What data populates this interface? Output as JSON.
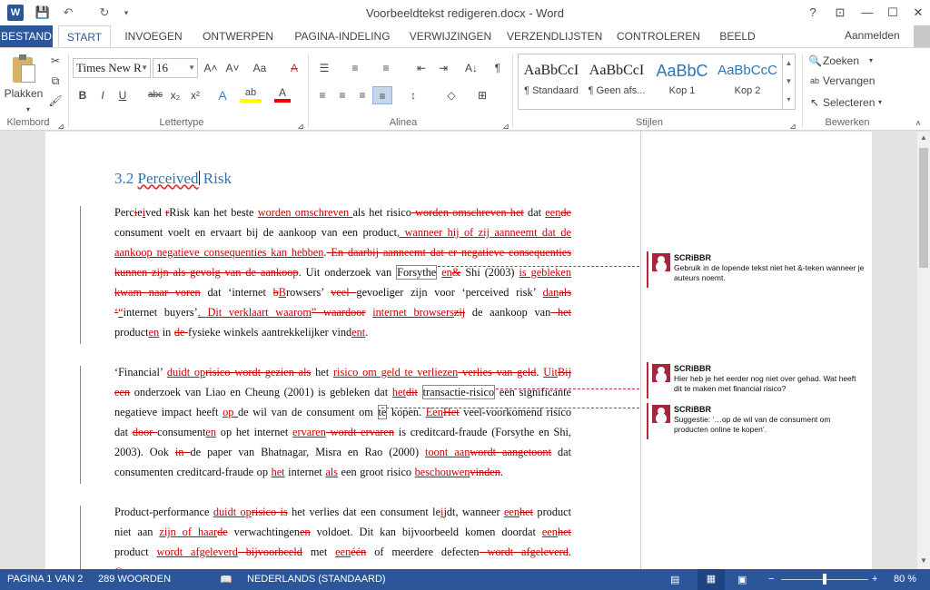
{
  "titlebar": {
    "app_icon": "W",
    "save": "💾",
    "undo": "↶",
    "redo": "↻",
    "customize": "▾",
    "title": "Voorbeeldtekst redigeren.docx - Word",
    "help": "?",
    "ribbon_opts": "⊡",
    "minimize": "—",
    "maximize": "☐",
    "close": "✕"
  },
  "tabs": {
    "file": "BESTAND",
    "items": [
      "START",
      "INVOEGEN",
      "ONTWERPEN",
      "PAGINA-INDELING",
      "VERWIJZINGEN",
      "VERZENDLIJSTEN",
      "CONTROLEREN",
      "BEELD"
    ],
    "signin": "Aanmelden"
  },
  "ribbon": {
    "clipboard": {
      "paste": "Plakken",
      "label": "Klembord"
    },
    "font": {
      "name": "Times New R",
      "size": "16",
      "grow": "A˄",
      "shrink": "A˅",
      "case": "Aa",
      "clear": "A",
      "bold": "B",
      "italic": "I",
      "underline": "U",
      "strike": "abc",
      "sub": "x₂",
      "sup": "x²",
      "effects": "A",
      "highlight": "ab",
      "color": "A",
      "label": "Lettertype"
    },
    "paragraph": {
      "bullets": "☰",
      "numbering": "≡",
      "multilevel": "≡",
      "decrease": "⇤",
      "increase": "⇥",
      "sort": "A↓",
      "pilcrow": "¶",
      "left": "≡",
      "center": "≡",
      "right": "≡",
      "justify": "≡",
      "spacing": "↕",
      "shading": "◇",
      "borders": "⊞",
      "label": "Alinea"
    },
    "styles": {
      "items": [
        {
          "preview": "AaBbCcI",
          "name": "¶ Standaard"
        },
        {
          "preview": "AaBbCcI",
          "name": "¶ Geen afs..."
        },
        {
          "preview": "AaBbC",
          "name": "Kop 1"
        },
        {
          "preview": "AaBbCcC",
          "name": "Kop 2"
        }
      ],
      "label": "Stijlen"
    },
    "editing": {
      "find": "Zoeken",
      "replace": "Vervangen",
      "select": "Selecteren",
      "label": "Bewerken"
    }
  },
  "document": {
    "heading": {
      "num": "3.2 ",
      "word1": "Perceived",
      "word2": " Risk"
    },
    "p1": [
      [
        "n",
        "Perc"
      ],
      [
        "d",
        "i"
      ],
      [
        "n",
        "e"
      ],
      [
        "i",
        "i"
      ],
      [
        "n",
        "ved "
      ],
      [
        "d",
        "r"
      ],
      [
        "n",
        "Risk kan het beste "
      ],
      [
        "i",
        "worden omschreven "
      ],
      [
        "n",
        "als het risico"
      ],
      [
        "d",
        " worden omschreven het"
      ],
      [
        "n",
        " dat "
      ],
      [
        "i",
        "een"
      ],
      [
        "d",
        "de"
      ],
      [
        "n",
        " consument voelt en ervaart bij de aankoop van een product"
      ],
      [
        "i",
        ", wanneer hij of zij aanneemt dat de aankoop negatieve consequenties kan hebben"
      ],
      [
        "n",
        "."
      ],
      [
        "d",
        " En daarbij aanneemt dat er negatieve consequenties kunnen zijn als gevolg van de aankoop"
      ],
      [
        "n",
        ". Uit onderzoek van "
      ],
      [
        "b",
        "Forsythe"
      ],
      [
        "n",
        " "
      ],
      [
        "i",
        "en"
      ],
      [
        "d",
        "&"
      ],
      [
        "n",
        " Shi (2003) "
      ],
      [
        "i",
        "is gebleken"
      ],
      [
        "d",
        " kwam naar voren"
      ],
      [
        "n",
        " dat ‘internet "
      ],
      [
        "d",
        "b"
      ],
      [
        "i",
        "B"
      ],
      [
        "n",
        "rowsers’ "
      ],
      [
        "d",
        " veel "
      ],
      [
        "n",
        "gevoeliger zijn voor ‘perceived risk’ "
      ],
      [
        "i",
        "dan"
      ],
      [
        "d",
        "als"
      ],
      [
        "n",
        " "
      ],
      [
        "d",
        "‘"
      ],
      [
        "i",
        "“"
      ],
      [
        "n",
        "internet buyers’"
      ],
      [
        "i",
        ". Dit verklaart waarom"
      ],
      [
        "d",
        "” waardoor"
      ],
      [
        "n",
        " "
      ],
      [
        "i",
        "internet browsers"
      ],
      [
        "d",
        "zij"
      ],
      [
        "n",
        " de aankoop van"
      ],
      [
        "d",
        " het"
      ],
      [
        "n",
        " product"
      ],
      [
        "i",
        "en"
      ],
      [
        "n",
        " in "
      ],
      [
        "d",
        "de "
      ],
      [
        "n",
        "fysieke winkels aantrekkelijker vind"
      ],
      [
        "i",
        "ent"
      ],
      [
        "n",
        "."
      ]
    ],
    "p2": [
      [
        "n",
        "‘Financial’ "
      ],
      [
        "i",
        "duidt op"
      ],
      [
        "d",
        "risico wordt gezien als"
      ],
      [
        "n",
        " het "
      ],
      [
        "i",
        "risico om geld te verliezen"
      ],
      [
        "d",
        " verlies van geld"
      ],
      [
        "n",
        ". "
      ],
      [
        "i",
        "Uit"
      ],
      [
        "d",
        "Bij een"
      ],
      [
        "n",
        " onderzoek van Liao en Cheung (2001) is gebleken dat "
      ],
      [
        "i",
        "het"
      ],
      [
        "d",
        "dit"
      ],
      [
        "n",
        " "
      ],
      [
        "b",
        "transactie-risico"
      ],
      [
        "n",
        " een significante negatieve impact heeft "
      ],
      [
        "i",
        "op "
      ],
      [
        "n",
        "de wil van de consument om "
      ],
      [
        "b",
        "te"
      ],
      [
        "n",
        " kopen. "
      ],
      [
        "i",
        "Een"
      ],
      [
        "d",
        "Het"
      ],
      [
        "n",
        " veel-voorkomend risico dat "
      ],
      [
        "d",
        "door "
      ],
      [
        "n",
        "consument"
      ],
      [
        "i",
        "en"
      ],
      [
        "n",
        " op het internet "
      ],
      [
        "i",
        "ervaren"
      ],
      [
        "d",
        " wordt ervaren"
      ],
      [
        "n",
        " is creditcard-fraude (Forsythe en Shi, 2003). Ook "
      ],
      [
        "d",
        "in "
      ],
      [
        "n",
        "de paper van Bhatnagar, Misra en Rao (2000) "
      ],
      [
        "i",
        "toont aan"
      ],
      [
        "d",
        "wordt aangetoont"
      ],
      [
        "n",
        " dat consumenten creditcard-fraude op "
      ],
      [
        "i",
        "het"
      ],
      [
        "n",
        " internet "
      ],
      [
        "i",
        "als"
      ],
      [
        "n",
        " een groot risico "
      ],
      [
        "i",
        "beschouwen"
      ],
      [
        "d",
        "vinden"
      ],
      [
        "n",
        "."
      ]
    ],
    "p3": [
      [
        "n",
        "Product-performance "
      ],
      [
        "i",
        "duidt op"
      ],
      [
        "d",
        "risico is"
      ],
      [
        "n",
        " het verlies dat een consument le"
      ],
      [
        "i",
        "i"
      ],
      [
        "n",
        "jdt, wanneer "
      ],
      [
        "i",
        "een"
      ],
      [
        "d",
        "het"
      ],
      [
        "n",
        " product niet aan "
      ],
      [
        "i",
        "zijn of haar"
      ],
      [
        "d",
        "de"
      ],
      [
        "n",
        " verwachtingen"
      ],
      [
        "d",
        "en"
      ],
      [
        "n",
        " voldoet. Dit kan bijvoorbeeld komen doordat "
      ],
      [
        "i",
        "een"
      ],
      [
        "d",
        "het"
      ],
      [
        "n",
        " product "
      ],
      [
        "i",
        "wordt afgeleverd"
      ],
      [
        "d",
        " bijvoorbeeld"
      ],
      [
        "n",
        " met "
      ],
      [
        "i",
        "een"
      ],
      [
        "d",
        "één"
      ],
      [
        "n",
        " of meerdere defecten"
      ],
      [
        "d",
        " wordt afgeleverd"
      ],
      [
        "n",
        ". "
      ],
      [
        "i",
        "Consumenten"
      ]
    ]
  },
  "comments": [
    {
      "author": "SCRiBBR",
      "text": "Gebruik in de lopende tekst niet het &-teken wanneer je auteurs noemt."
    },
    {
      "author": "SCRiBBR",
      "text": "Hier heb je het eerder nog niet over gehad. Wat heeft dit te maken met financial risico?"
    },
    {
      "author": "SCRiBBR",
      "text": "Suggestie: ‘…op de wil van de consument om producten online te kopen’."
    }
  ],
  "status": {
    "page": "PAGINA 1 VAN 2",
    "words": "289 WOORDEN",
    "language": "NEDERLANDS (STANDAARD)",
    "zoom": "80 %",
    "zoom_fraction": 0.5
  }
}
